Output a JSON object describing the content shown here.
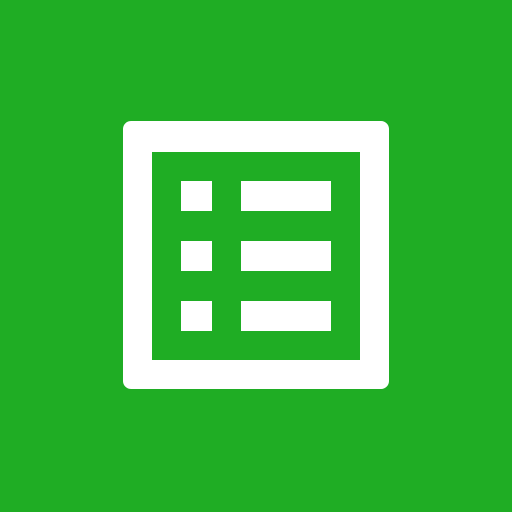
{
  "tile": {
    "icon": "list-form-icon",
    "colors": {
      "background": "#1fad24",
      "foreground": "#ffffff"
    },
    "rows": 3
  }
}
